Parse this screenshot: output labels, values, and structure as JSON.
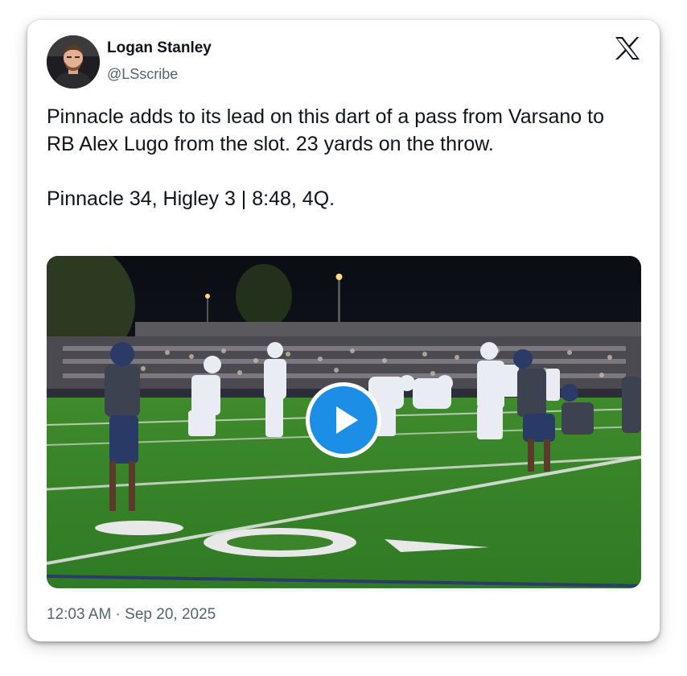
{
  "tweet": {
    "author_name": "Logan Stanley",
    "author_handle": "@LSscribe",
    "text_paragraph_1": "Pinnacle adds to its lead on this dart of a pass from Varsano to RB Alex Lugo from the slot. 23 yards on the throw.",
    "text_paragraph_2": "Pinnacle 34, Higley 3 | 8:48, 4Q.",
    "timestamp": "12:03 AM · Sep 20, 2025"
  },
  "icons": {
    "platform_logo": "x-logo-icon",
    "play": "play-icon"
  },
  "colors": {
    "text_primary": "#0f1419",
    "text_secondary": "#536471",
    "play_button": "#1d8ee6"
  }
}
